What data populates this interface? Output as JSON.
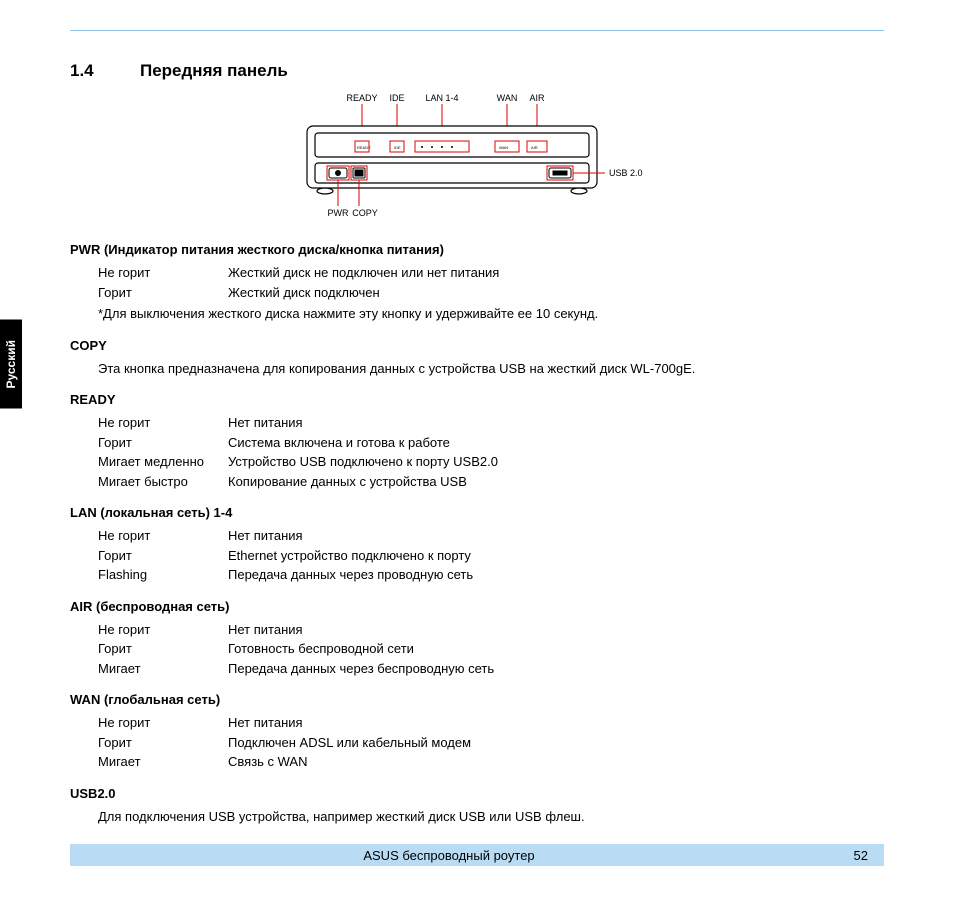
{
  "side_tab": "Русский",
  "section_number": "1.4",
  "section_title": "Передняя панель",
  "diagram_labels": {
    "ready": "READY",
    "ide": "IDE",
    "lan": "LAN 1-4",
    "wan": "WAN",
    "air": "AIR",
    "usb": "USB 2.0",
    "pwr": "PWR",
    "copy": "COPY"
  },
  "pwr": {
    "heading": "PWR (Индикатор питания жесткого диска/кнопка питания)",
    "rows": [
      {
        "state": "Не горит",
        "desc": "Жесткий диск не подключен или нет питания"
      },
      {
        "state": "Горит",
        "desc": "Жесткий диск подключен"
      }
    ],
    "note": "*Для выключения жесткого диска нажмите эту кнопку и удерживайте ее 10 секунд."
  },
  "copy": {
    "heading": "COPY",
    "text": "Эта кнопка предназначена для копирования данных с устройства USB на жесткий диск WL-700gE."
  },
  "ready": {
    "heading": "READY",
    "rows": [
      {
        "state": "Не горит",
        "desc": "Нет питания"
      },
      {
        "state": "Горит",
        "desc": "Система включена и готова к работе"
      },
      {
        "state": "Мигает медленно",
        "desc": "Устройство USB подключено к порту USB2.0"
      },
      {
        "state": "Мигает быстро",
        "desc": "Копирование данных с устройства USB"
      }
    ]
  },
  "lan": {
    "heading": "LAN (локальная сеть) 1-4",
    "rows": [
      {
        "state": "Не горит",
        "desc": "Нет питания"
      },
      {
        "state": "Горит",
        "desc": "Ethernet устройство подключено к порту"
      },
      {
        "state": "Flashing",
        "desc": "Передача данных через проводную сеть"
      }
    ]
  },
  "air": {
    "heading": "AIR (беспроводная сеть)",
    "rows": [
      {
        "state": "Не горит",
        "desc": "Нет питания"
      },
      {
        "state": "Горит",
        "desc": "Готовность беспроводной сети"
      },
      {
        "state": "Мигает",
        "desc": "Передача данных через беспроводную сеть"
      }
    ]
  },
  "wan": {
    "heading": "WAN (глобальная сеть)",
    "rows": [
      {
        "state": "Не горит",
        "desc": "Нет питания"
      },
      {
        "state": "Горит",
        "desc": "Подключен ADSL или кабельный модем"
      },
      {
        "state": "Мигает",
        "desc": "Связь с WAN"
      }
    ]
  },
  "usb": {
    "heading": "USB2.0",
    "text": "Для подключения USB устройства, например жесткий диск USB или USB флеш."
  },
  "footer": {
    "title": "ASUS беспроводный роутер",
    "page": "52"
  }
}
